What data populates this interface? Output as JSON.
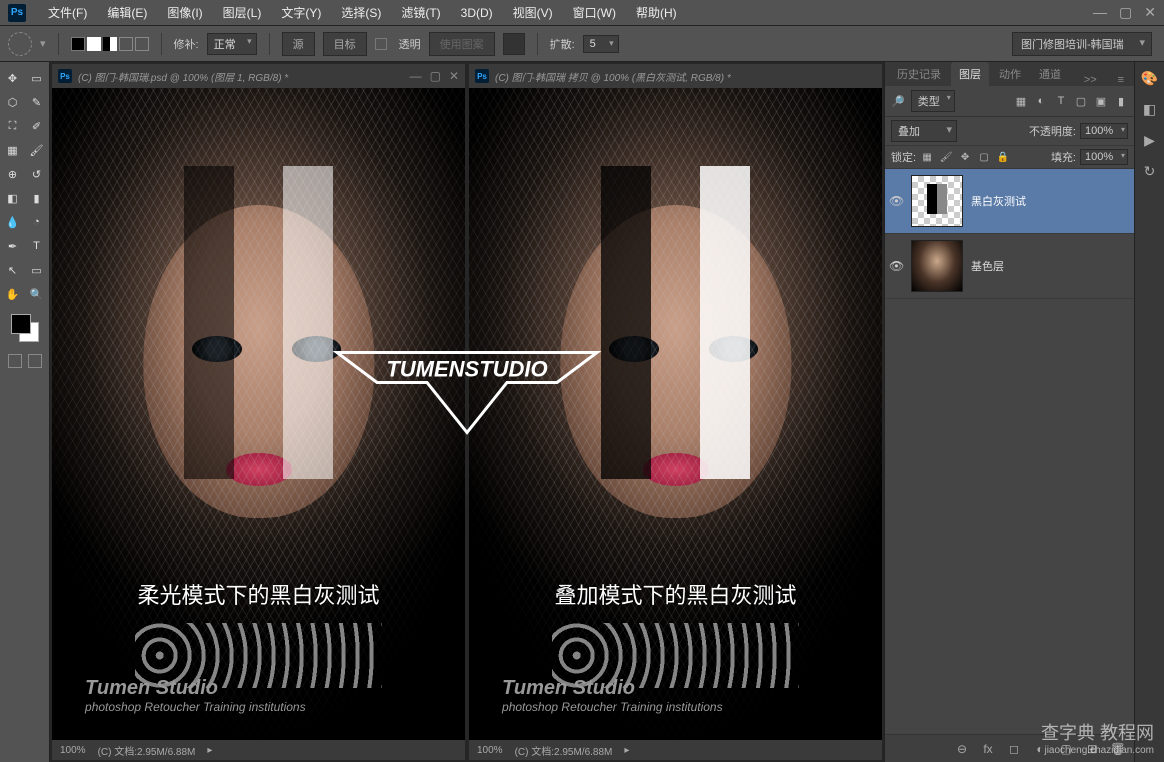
{
  "app": {
    "icon": "Ps"
  },
  "menu": [
    "文件(F)",
    "编辑(E)",
    "图像(I)",
    "图层(L)",
    "文字(Y)",
    "选择(S)",
    "滤镜(T)",
    "3D(D)",
    "视图(V)",
    "窗口(W)",
    "帮助(H)"
  ],
  "optionsBar": {
    "patchLabel": "修补:",
    "patchMode": "正常",
    "sourceBtn": "源",
    "destBtn": "目标",
    "transparentLabel": "透明",
    "usePatternBtn": "使用图案",
    "diffusionLabel": "扩散:",
    "diffusionValue": "5",
    "workspaceTitle": "图门修图培训-韩国瑞"
  },
  "documents": [
    {
      "tabTitle": "(C) 图门-韩国瑞.psd @ 100% (图层 1, RGB/8) *",
      "caption": "柔光模式下的黑白灰测试",
      "studioLine1": "Tumen Studio",
      "studioLine2": "photoshop Retoucher Training institutions",
      "zoom": "100%",
      "docInfo": "(C) 文档:2.95M/6.88M"
    },
    {
      "tabTitle": "(C) 图门-韩国瑞 拷贝 @ 100% (黑白灰测试, RGB/8) *",
      "caption": "叠加模式下的黑白灰测试",
      "studioLine1": "Tumen Studio",
      "studioLine2": "photoshop Retoucher Training institutions",
      "zoom": "100%",
      "docInfo": "(C) 文档:2.95M/6.88M"
    }
  ],
  "logoText": "TUMENSTUDIO",
  "panels": {
    "tabs": {
      "history": "历史记录",
      "layers": "图层",
      "actions": "动作",
      "channels": "通道",
      "more": ">>"
    },
    "layerFilter": {
      "kindLabel": "类型"
    },
    "blend": {
      "mode": "叠加",
      "opacityLabel": "不透明度:",
      "opacityValue": "100%"
    },
    "lock": {
      "label": "锁定:",
      "fillLabel": "填充:",
      "fillValue": "100%"
    },
    "layers": [
      {
        "name": "黑白灰测试",
        "visible": true,
        "thumb": "bars",
        "selected": true
      },
      {
        "name": "基色层",
        "visible": true,
        "thumb": "portrait",
        "selected": false
      }
    ],
    "footerIcons": {
      "link": "⊖",
      "fx": "fx",
      "mask": "◻",
      "adjust": "◐",
      "group": "▢",
      "new": "⊞",
      "trash": "🗑"
    }
  },
  "watermark": {
    "main": "查字典 教程网",
    "sub": "jiaocheng.chazidian.com"
  }
}
